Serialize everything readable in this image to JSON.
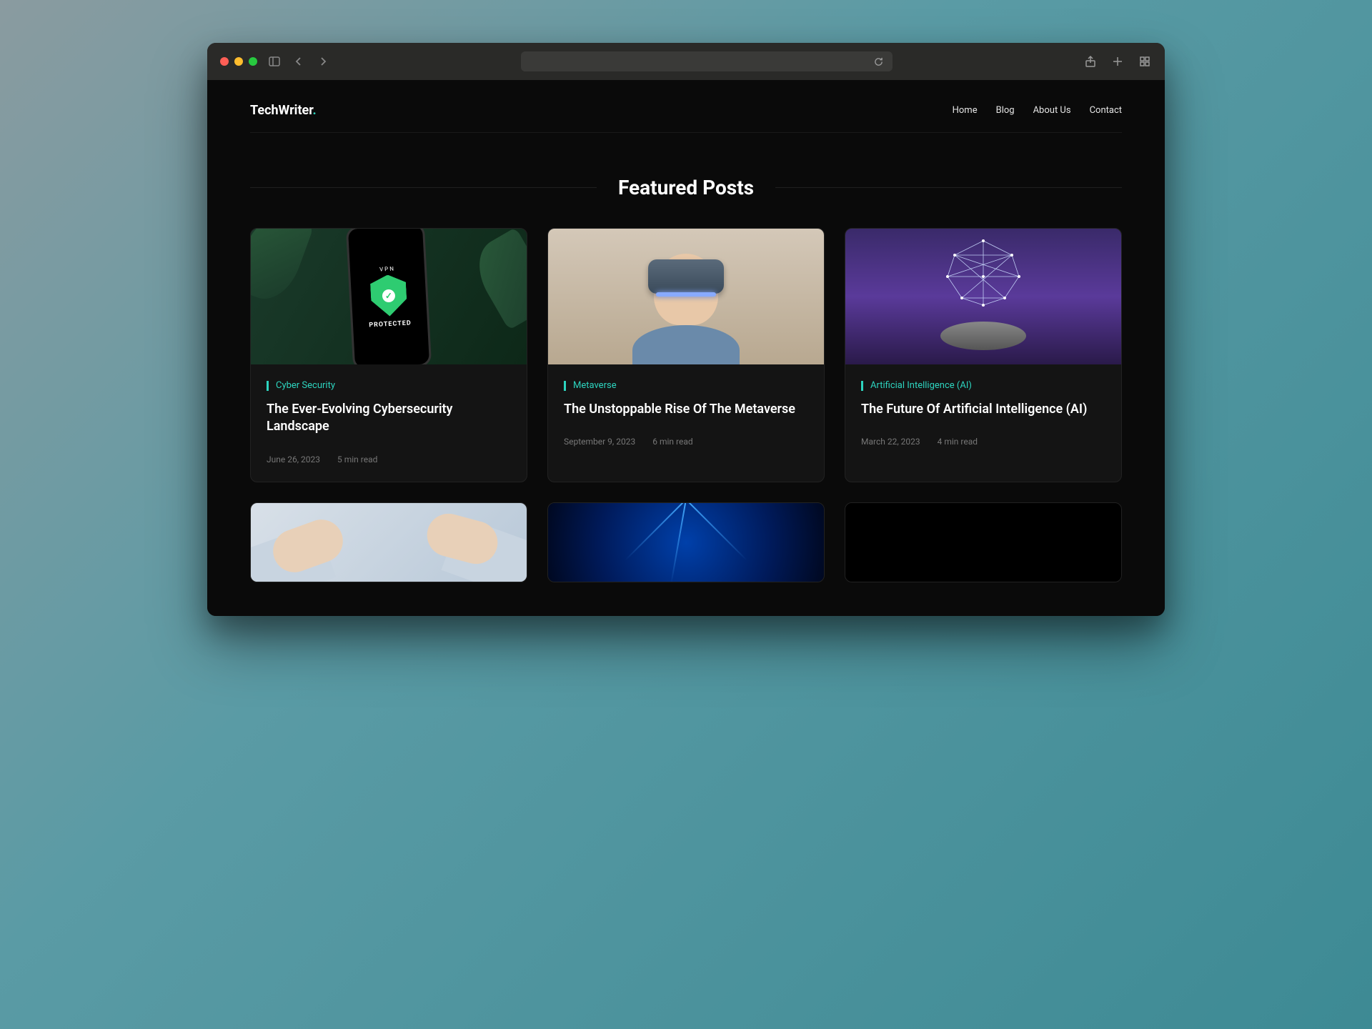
{
  "site": {
    "logo_main": "TechWriter",
    "logo_accent": "."
  },
  "nav": {
    "items": [
      "Home",
      "Blog",
      "About Us",
      "Contact"
    ]
  },
  "section": {
    "title": "Featured Posts"
  },
  "posts": [
    {
      "category": "Cyber Security",
      "title": "The Ever-Evolving Cybersecurity Landscape",
      "date": "June 26, 2023",
      "read": "5 min read"
    },
    {
      "category": "Metaverse",
      "title": "The Unstoppable Rise Of The Metaverse",
      "date": "September 9, 2023",
      "read": "6 min read"
    },
    {
      "category": "Artificial Intelligence (AI)",
      "title": "The Future Of Artificial Intelligence (AI)",
      "date": "March 22, 2023",
      "read": "4 min read"
    }
  ],
  "thumb_text": {
    "vpn": "VPN",
    "protected": "PROTECTED"
  },
  "colors": {
    "accent": "#2dd4bf"
  }
}
